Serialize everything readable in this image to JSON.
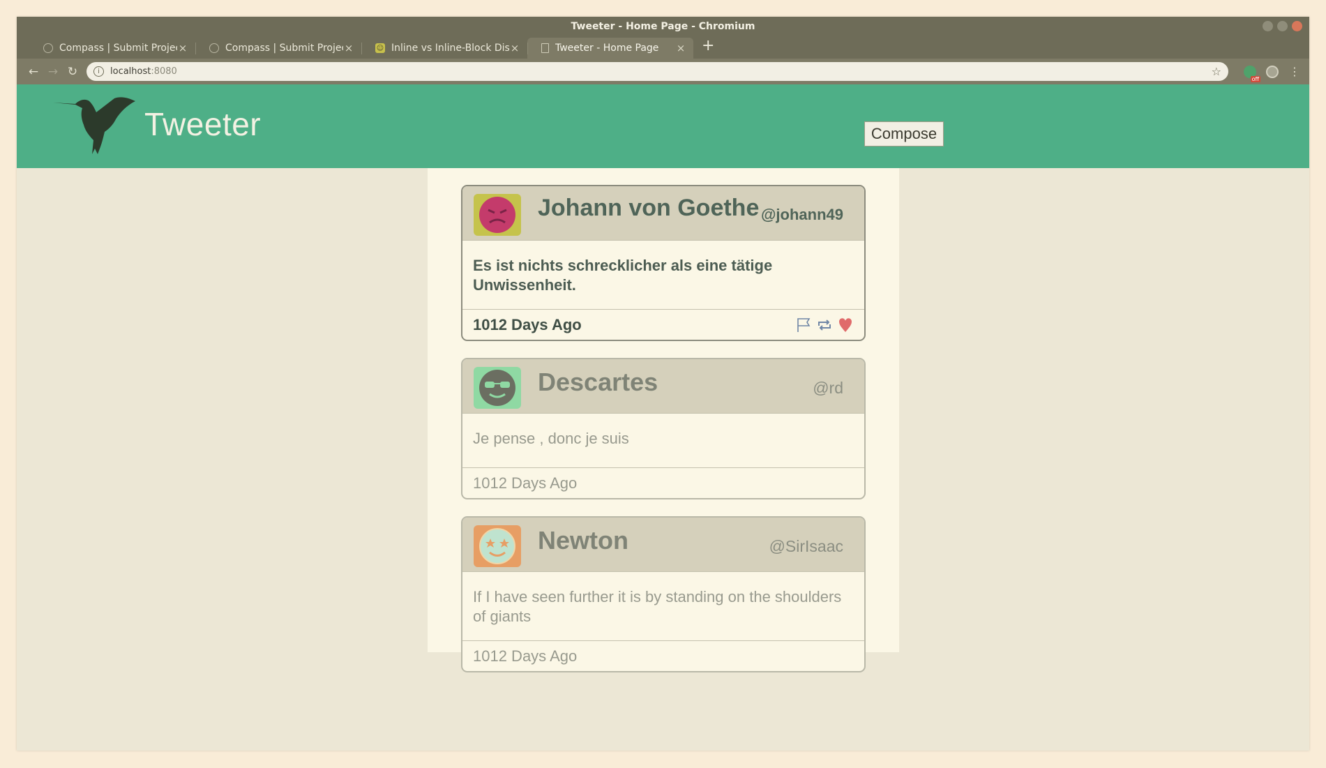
{
  "browser": {
    "window_title": "Tweeter - Home Page - Chromium",
    "tabs": [
      {
        "label": "Compass | Submit Project",
        "icon": "globe-icon",
        "active": false
      },
      {
        "label": "Compass | Submit Project",
        "icon": "globe-icon",
        "active": false
      },
      {
        "label": "Inline vs Inline-Block Disp",
        "icon": "site-favicon-icon",
        "active": false
      },
      {
        "label": "Tweeter - Home Page",
        "icon": "page-icon",
        "active": true
      }
    ],
    "url_host": "localhost",
    "url_port": ":8080",
    "extension_badge": "off"
  },
  "site": {
    "brand": "Tweeter",
    "compose_label": "Compose"
  },
  "tweets": [
    {
      "name": "Johann von Goethe",
      "handle": "@johann49",
      "content": "Es ist nichts schrecklicher als eine tätige Unwissenheit.",
      "age": "1012 Days Ago",
      "avatar_color": "#c5c34b",
      "avatar_face": "#c43b6b",
      "hovered": true
    },
    {
      "name": "Descartes",
      "handle": "@rd",
      "content": "Je pense , donc je suis",
      "age": "1012 Days Ago",
      "avatar_color": "#8fd9a3",
      "avatar_face": "#6b6e61",
      "hovered": false
    },
    {
      "name": "Newton",
      "handle": "@SirIsaac",
      "content": "If I have seen further it is by standing on the shoulders of giants",
      "age": "1012 Days Ago",
      "avatar_color": "#e79e64",
      "avatar_face": "#bfe3cf",
      "hovered": false
    }
  ],
  "colors": {
    "header_green": "#4eaf87",
    "page_bg": "#ece7d5",
    "feed_bg": "#fbf7e6"
  }
}
